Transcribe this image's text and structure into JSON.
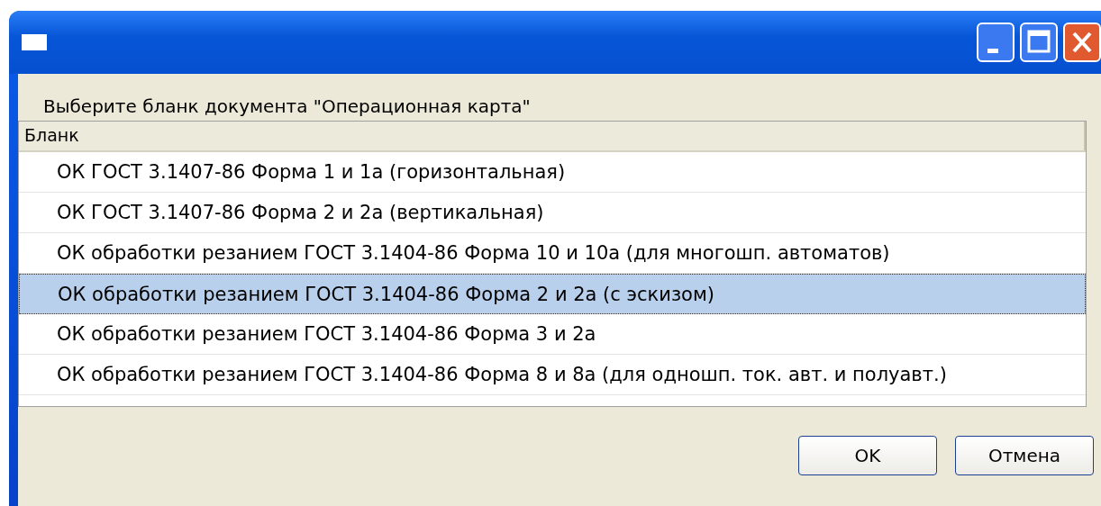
{
  "prompt": "Выберите бланк документа \"Операционная карта\"",
  "table": {
    "columns": [
      "Бланк"
    ],
    "rows": [
      {
        "cells": [
          "ОК ГОСТ 3.1407-86 Форма 1 и 1а (горизонтальная)"
        ],
        "selected": false
      },
      {
        "cells": [
          "ОК ГОСТ 3.1407-86 Форма 2 и 2а (вертикальная)"
        ],
        "selected": false
      },
      {
        "cells": [
          "ОК обработки резанием ГОСТ 3.1404-86 Форма 10 и 10а (для многошп. автоматов)"
        ],
        "selected": false
      },
      {
        "cells": [
          "ОК обработки резанием ГОСТ 3.1404-86 Форма 2 и 2а (с эскизом)"
        ],
        "selected": true
      },
      {
        "cells": [
          "ОК обработки резанием ГОСТ 3.1404-86 Форма 3 и 2а"
        ],
        "selected": false
      },
      {
        "cells": [
          "ОК обработки резанием ГОСТ 3.1404-86 Форма 8 и 8а (для одношп. ток. авт. и полуавт.)"
        ],
        "selected": false
      }
    ]
  },
  "buttons": [
    "OK",
    "Отмена"
  ]
}
